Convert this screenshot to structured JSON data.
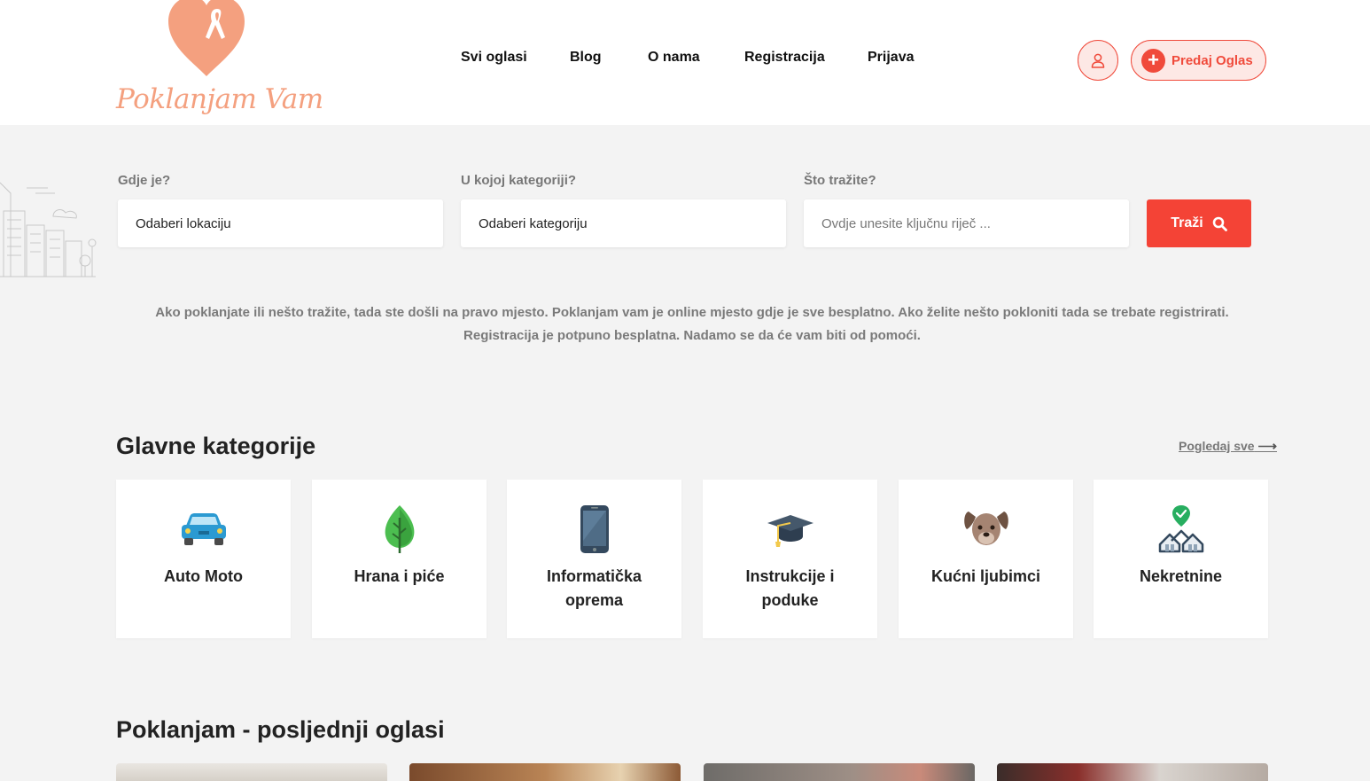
{
  "brand": {
    "name": "Poklanjam Vam",
    "color": "#f4a07f",
    "accent": "#f04a3b"
  },
  "nav": [
    "Svi oglasi",
    "Blog",
    "O nama",
    "Registracija",
    "Prijava"
  ],
  "header": {
    "user_icon": "user-icon",
    "post_button": "Predaj Oglas"
  },
  "search": {
    "location_label": "Gdje je?",
    "location_value": "Odaberi lokaciju",
    "category_label": "U kojoj kategoriji?",
    "category_value": "Odaberi kategoriju",
    "keyword_label": "Što tražite?",
    "keyword_placeholder": "Ovdje unesite ključnu riječ ...",
    "button": "Traži"
  },
  "intro": "Ako poklanjate ili nešto tražite, tada ste došli na pravo mjesto. Poklanjam vam je online mjesto gdje je sve besplatno. Ako želite nešto pokloniti tada se trebate registrirati. Registracija je potpuno besplatna. Nadamo se da će vam biti od pomoći.",
  "categories": {
    "title": "Glavne kategorije",
    "see_all": "Pogledaj sve",
    "items": [
      {
        "label": "Auto Moto",
        "icon": "car-icon"
      },
      {
        "label": "Hrana i piće",
        "icon": "leaf-icon"
      },
      {
        "label": "Informatička oprema",
        "icon": "phone-icon"
      },
      {
        "label": "Instrukcije i poduke",
        "icon": "graduation-cap-icon"
      },
      {
        "label": "Kućni ljubimci",
        "icon": "dog-icon"
      },
      {
        "label": "Nekretnine",
        "icon": "real-estate-icon"
      }
    ]
  },
  "latest": {
    "title": "Poklanjam - posljednji oglasi"
  }
}
